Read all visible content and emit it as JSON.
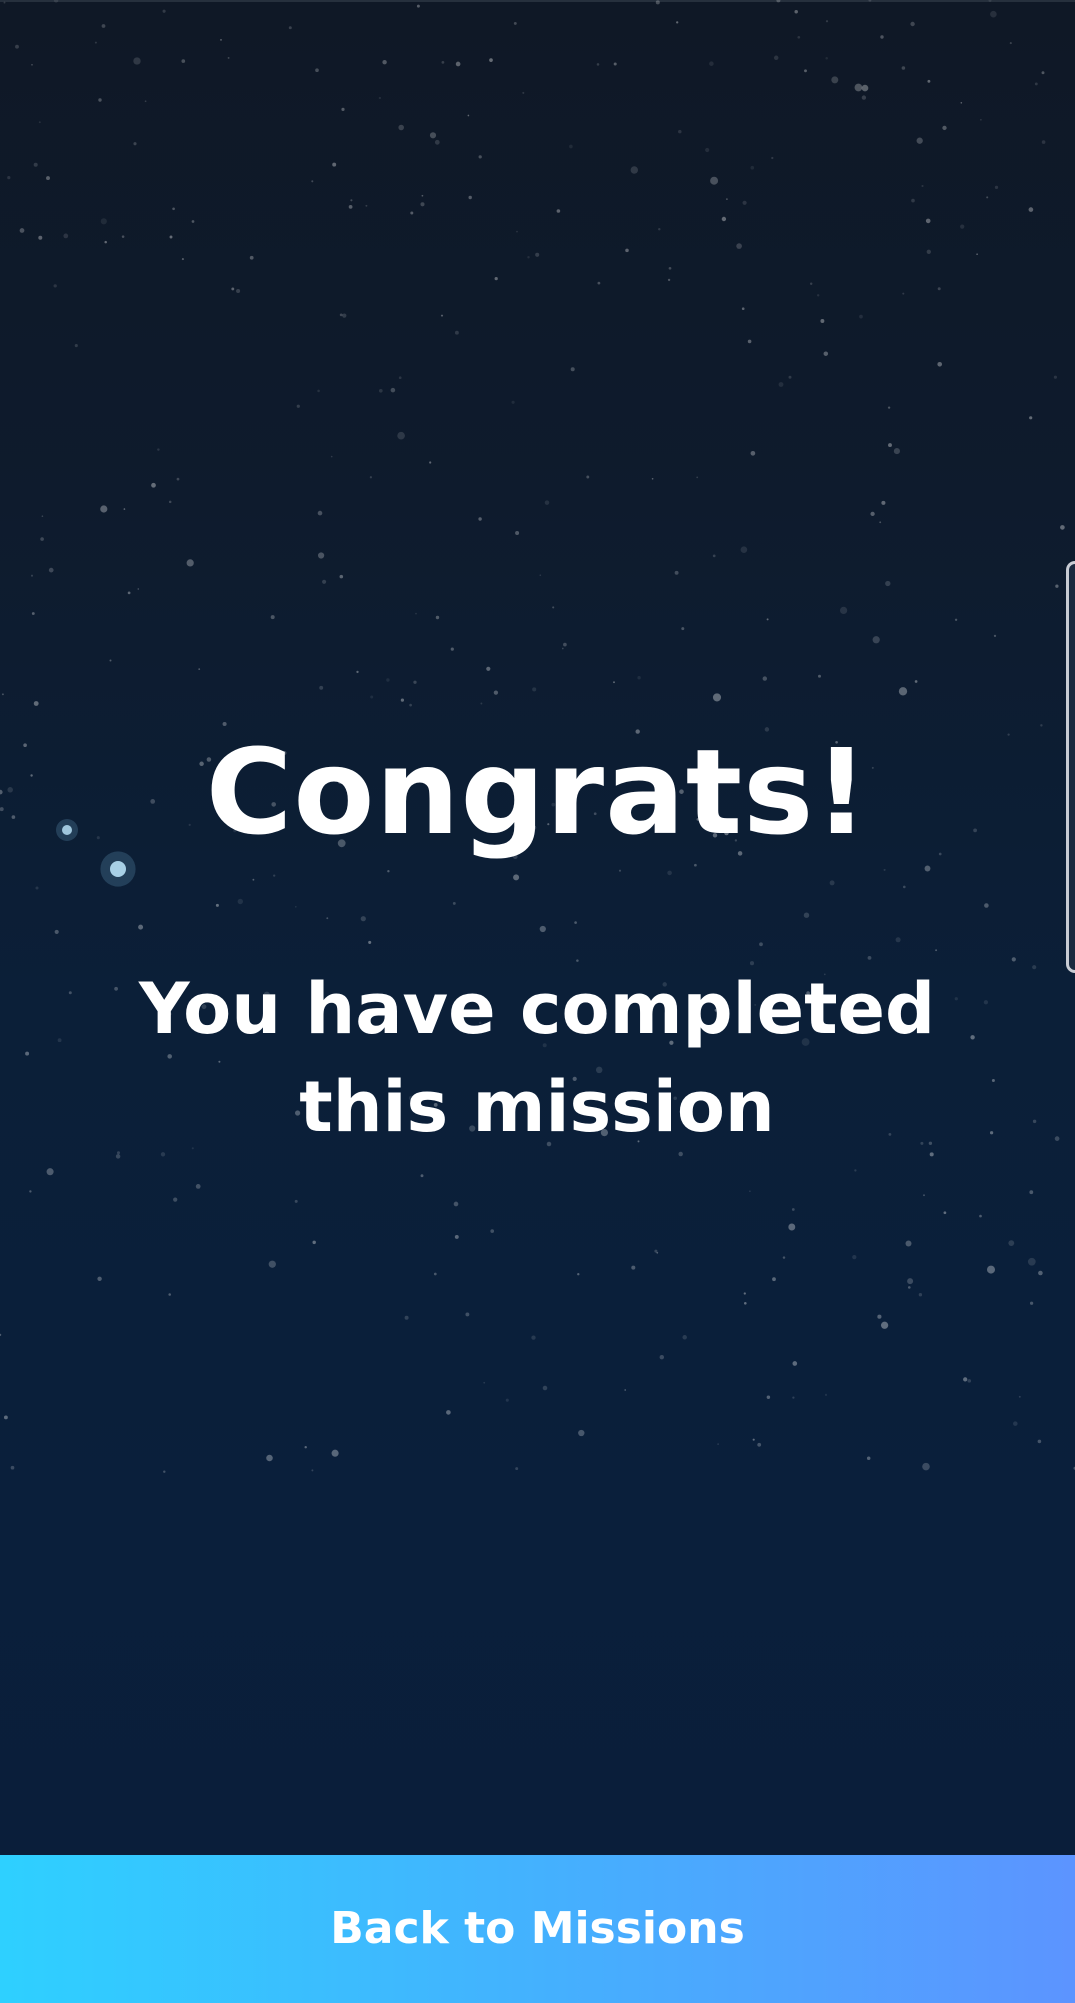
{
  "screen": {
    "title": "Congrats!",
    "message": "You have completed this mission"
  },
  "footer": {
    "back_label": "Back to Missions"
  },
  "colors": {
    "background_top": "#0f1826",
    "background_bottom": "#0a1e3a",
    "text": "#ffffff",
    "button_gradient_start": "#2ed0ff",
    "button_gradient_end": "#5c94ff"
  }
}
